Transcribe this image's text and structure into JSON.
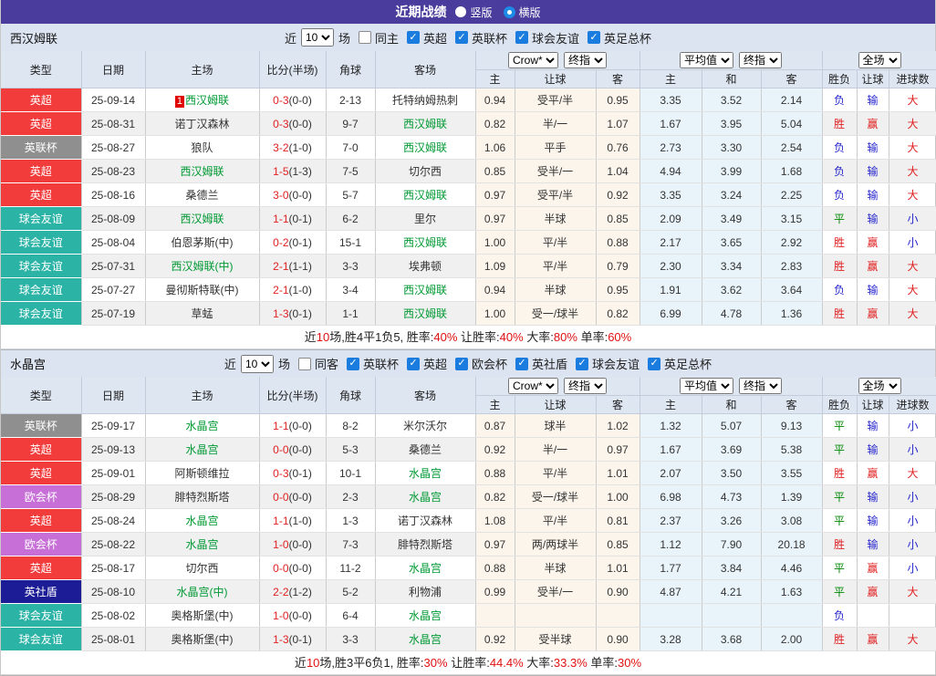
{
  "header": {
    "title": "近期战绩",
    "radios": [
      {
        "label": "竖版",
        "selected": false
      },
      {
        "label": "横版",
        "selected": true
      }
    ]
  },
  "table_headers": {
    "type": "类型",
    "date": "日期",
    "home": "主场",
    "score": "比分(半场)",
    "corner": "角球",
    "away": "客场",
    "selects": {
      "bookmaker": "Crow*",
      "final1": "终指",
      "average": "平均值",
      "final2": "终指",
      "fulltime": "全场"
    },
    "sub": [
      "主",
      "让球",
      "客",
      "主",
      "和",
      "客",
      "胜负",
      "让球",
      "进球数"
    ]
  },
  "colors": {
    "league": {
      "英超": "#f23b3b",
      "英联杯": "#8f8f8f",
      "球会友谊": "#2bb3a6",
      "欧会杯": "#c76fd6",
      "英社盾": "#1c1c96"
    },
    "result": {
      "r": "#e02020",
      "g": "#008800",
      "b": "#2525cc"
    },
    "team_green": "#009933",
    "accent": "#4a3c9c"
  },
  "sections": [
    {
      "team": "西汉姆联",
      "filter": {
        "near_label": "近",
        "count": "10",
        "games_label": "场",
        "same_label": "同主",
        "same_checked": false,
        "leagues": [
          {
            "label": "英超",
            "checked": true
          },
          {
            "label": "英联杯",
            "checked": true
          },
          {
            "label": "球会友谊",
            "checked": true
          },
          {
            "label": "英足总杯",
            "checked": true
          }
        ]
      },
      "rows": [
        {
          "type": "英超",
          "date": "25-09-14",
          "rank": "1",
          "home": "西汉姆联",
          "home_green": true,
          "score": "0-3",
          "half": "(0-0)",
          "corner": "2-13",
          "away": "托特纳姆热刺",
          "away_green": false,
          "h1": "0.94",
          "hc": "受平/半",
          "h2": "0.95",
          "e1": "3.35",
          "e2": "3.52",
          "e3": "2.14",
          "r1": "负",
          "c1": "b",
          "r2": "输",
          "c2": "b",
          "r3": "大",
          "c3": "r"
        },
        {
          "type": "英超",
          "date": "25-08-31",
          "home": "诺丁汉森林",
          "home_green": false,
          "score": "0-3",
          "half": "(0-0)",
          "corner": "9-7",
          "away": "西汉姆联",
          "away_green": true,
          "h1": "0.82",
          "hc": "半/一",
          "h2": "1.07",
          "e1": "1.67",
          "e2": "3.95",
          "e3": "5.04",
          "r1": "胜",
          "c1": "r",
          "r2": "赢",
          "c2": "r",
          "r3": "大",
          "c3": "r"
        },
        {
          "type": "英联杯",
          "date": "25-08-27",
          "home": "狼队",
          "home_green": false,
          "score": "3-2",
          "half": "(1-0)",
          "corner": "7-0",
          "away": "西汉姆联",
          "away_green": true,
          "h1": "1.06",
          "hc": "平手",
          "h2": "0.76",
          "e1": "2.73",
          "e2": "3.30",
          "e3": "2.54",
          "r1": "负",
          "c1": "b",
          "r2": "输",
          "c2": "b",
          "r3": "大",
          "c3": "r"
        },
        {
          "type": "英超",
          "date": "25-08-23",
          "home": "西汉姆联",
          "home_green": true,
          "score": "1-5",
          "half": "(1-3)",
          "corner": "7-5",
          "away": "切尔西",
          "away_green": false,
          "h1": "0.85",
          "hc": "受半/一",
          "h2": "1.04",
          "e1": "4.94",
          "e2": "3.99",
          "e3": "1.68",
          "r1": "负",
          "c1": "b",
          "r2": "输",
          "c2": "b",
          "r3": "大",
          "c3": "r"
        },
        {
          "type": "英超",
          "date": "25-08-16",
          "home": "桑德兰",
          "home_green": false,
          "score": "3-0",
          "half": "(0-0)",
          "corner": "5-7",
          "away": "西汉姆联",
          "away_green": true,
          "h1": "0.97",
          "hc": "受平/半",
          "h2": "0.92",
          "e1": "3.35",
          "e2": "3.24",
          "e3": "2.25",
          "r1": "负",
          "c1": "b",
          "r2": "输",
          "c2": "b",
          "r3": "大",
          "c3": "r"
        },
        {
          "type": "球会友谊",
          "date": "25-08-09",
          "home": "西汉姆联",
          "home_green": true,
          "score": "1-1",
          "half": "(0-1)",
          "corner": "6-2",
          "away": "里尔",
          "away_green": false,
          "h1": "0.97",
          "hc": "半球",
          "h2": "0.85",
          "e1": "2.09",
          "e2": "3.49",
          "e3": "3.15",
          "r1": "平",
          "c1": "g",
          "r2": "输",
          "c2": "b",
          "r3": "小",
          "c3": "b"
        },
        {
          "type": "球会友谊",
          "date": "25-08-04",
          "home": "伯恩茅斯(中)",
          "home_green": false,
          "score": "0-2",
          "half": "(0-1)",
          "corner": "15-1",
          "away": "西汉姆联",
          "away_green": true,
          "h1": "1.00",
          "hc": "平/半",
          "h2": "0.88",
          "e1": "2.17",
          "e2": "3.65",
          "e3": "2.92",
          "r1": "胜",
          "c1": "r",
          "r2": "赢",
          "c2": "r",
          "r3": "小",
          "c3": "b"
        },
        {
          "type": "球会友谊",
          "date": "25-07-31",
          "home": "西汉姆联(中)",
          "home_green": true,
          "score": "2-1",
          "half": "(1-1)",
          "corner": "3-3",
          "away": "埃弗顿",
          "away_green": false,
          "h1": "1.09",
          "hc": "平/半",
          "h2": "0.79",
          "e1": "2.30",
          "e2": "3.34",
          "e3": "2.83",
          "r1": "胜",
          "c1": "r",
          "r2": "赢",
          "c2": "r",
          "r3": "大",
          "c3": "r"
        },
        {
          "type": "球会友谊",
          "date": "25-07-27",
          "home": "曼彻斯特联(中)",
          "home_green": false,
          "score": "2-1",
          "half": "(1-0)",
          "corner": "3-4",
          "away": "西汉姆联",
          "away_green": true,
          "h1": "0.94",
          "hc": "半球",
          "h2": "0.95",
          "e1": "1.91",
          "e2": "3.62",
          "e3": "3.64",
          "r1": "负",
          "c1": "b",
          "r2": "输",
          "c2": "b",
          "r3": "大",
          "c3": "r"
        },
        {
          "type": "球会友谊",
          "date": "25-07-19",
          "home": "草蜢",
          "home_green": false,
          "score": "1-3",
          "half": "(0-1)",
          "corner": "1-1",
          "away": "西汉姆联",
          "away_green": true,
          "h1": "1.00",
          "hc": "受一/球半",
          "h2": "0.82",
          "e1": "6.99",
          "e2": "4.78",
          "e3": "1.36",
          "r1": "胜",
          "c1": "r",
          "r2": "赢",
          "c2": "r",
          "r3": "大",
          "c3": "r"
        }
      ],
      "summary": [
        {
          "t": "近"
        },
        {
          "t": "10",
          "red": true
        },
        {
          "t": "场,胜4平1负5, 胜率:"
        },
        {
          "t": "40%",
          "red": true
        },
        {
          "t": " 让胜率:"
        },
        {
          "t": "40%",
          "red": true
        },
        {
          "t": " 大率:"
        },
        {
          "t": "80%",
          "red": true
        },
        {
          "t": " 单率:"
        },
        {
          "t": "60%",
          "red": true
        }
      ]
    },
    {
      "team": "水晶宫",
      "filter": {
        "near_label": "近",
        "count": "10",
        "games_label": "场",
        "same_label": "同客",
        "same_checked": false,
        "leagues": [
          {
            "label": "英联杯",
            "checked": true
          },
          {
            "label": "英超",
            "checked": true
          },
          {
            "label": "欧会杯",
            "checked": true
          },
          {
            "label": "英社盾",
            "checked": true
          },
          {
            "label": "球会友谊",
            "checked": true
          },
          {
            "label": "英足总杯",
            "checked": true
          }
        ]
      },
      "rows": [
        {
          "type": "英联杯",
          "date": "25-09-17",
          "home": "水晶宫",
          "home_green": true,
          "score": "1-1",
          "half": "(0-0)",
          "corner": "8-2",
          "away": "米尔沃尔",
          "away_green": false,
          "h1": "0.87",
          "hc": "球半",
          "h2": "1.02",
          "e1": "1.32",
          "e2": "5.07",
          "e3": "9.13",
          "r1": "平",
          "c1": "g",
          "r2": "输",
          "c2": "b",
          "r3": "小",
          "c3": "b"
        },
        {
          "type": "英超",
          "date": "25-09-13",
          "home": "水晶宫",
          "home_green": true,
          "score": "0-0",
          "half": "(0-0)",
          "corner": "5-3",
          "away": "桑德兰",
          "away_green": false,
          "h1": "0.92",
          "hc": "半/一",
          "h2": "0.97",
          "e1": "1.67",
          "e2": "3.69",
          "e3": "5.38",
          "r1": "平",
          "c1": "g",
          "r2": "输",
          "c2": "b",
          "r3": "小",
          "c3": "b"
        },
        {
          "type": "英超",
          "date": "25-09-01",
          "home": "阿斯顿维拉",
          "home_green": false,
          "score": "0-3",
          "half": "(0-1)",
          "corner": "10-1",
          "away": "水晶宫",
          "away_green": true,
          "h1": "0.88",
          "hc": "平/半",
          "h2": "1.01",
          "e1": "2.07",
          "e2": "3.50",
          "e3": "3.55",
          "r1": "胜",
          "c1": "r",
          "r2": "赢",
          "c2": "r",
          "r3": "大",
          "c3": "r"
        },
        {
          "type": "欧会杯",
          "date": "25-08-29",
          "home": "腓特烈斯塔",
          "home_green": false,
          "score": "0-0",
          "half": "(0-0)",
          "corner": "2-3",
          "away": "水晶宫",
          "away_green": true,
          "h1": "0.82",
          "hc": "受一/球半",
          "h2": "1.00",
          "e1": "6.98",
          "e2": "4.73",
          "e3": "1.39",
          "r1": "平",
          "c1": "g",
          "r2": "输",
          "c2": "b",
          "r3": "小",
          "c3": "b"
        },
        {
          "type": "英超",
          "date": "25-08-24",
          "home": "水晶宫",
          "home_green": true,
          "score": "1-1",
          "half": "(1-0)",
          "corner": "1-3",
          "away": "诺丁汉森林",
          "away_green": false,
          "h1": "1.08",
          "hc": "平/半",
          "h2": "0.81",
          "e1": "2.37",
          "e2": "3.26",
          "e3": "3.08",
          "r1": "平",
          "c1": "g",
          "r2": "输",
          "c2": "b",
          "r3": "小",
          "c3": "b"
        },
        {
          "type": "欧会杯",
          "date": "25-08-22",
          "home": "水晶宫",
          "home_green": true,
          "score": "1-0",
          "half": "(0-0)",
          "corner": "7-3",
          "away": "腓特烈斯塔",
          "away_green": false,
          "h1": "0.97",
          "hc": "两/两球半",
          "h2": "0.85",
          "e1": "1.12",
          "e2": "7.90",
          "e3": "20.18",
          "r1": "胜",
          "c1": "r",
          "r2": "输",
          "c2": "b",
          "r3": "小",
          "c3": "b"
        },
        {
          "type": "英超",
          "date": "25-08-17",
          "home": "切尔西",
          "home_green": false,
          "score": "0-0",
          "half": "(0-0)",
          "corner": "11-2",
          "away": "水晶宫",
          "away_green": true,
          "h1": "0.88",
          "hc": "半球",
          "h2": "1.01",
          "e1": "1.77",
          "e2": "3.84",
          "e3": "4.46",
          "r1": "平",
          "c1": "g",
          "r2": "赢",
          "c2": "r",
          "r3": "小",
          "c3": "b"
        },
        {
          "type": "英社盾",
          "date": "25-08-10",
          "home": "水晶宫(中)",
          "home_green": true,
          "score": "2-2",
          "half": "(1-2)",
          "corner": "5-2",
          "away": "利物浦",
          "away_green": false,
          "h1": "0.99",
          "hc": "受半/一",
          "h2": "0.90",
          "e1": "4.87",
          "e2": "4.21",
          "e3": "1.63",
          "r1": "平",
          "c1": "g",
          "r2": "赢",
          "c2": "r",
          "r3": "大",
          "c3": "r"
        },
        {
          "type": "球会友谊",
          "date": "25-08-02",
          "home": "奥格斯堡(中)",
          "home_green": false,
          "score": "1-0",
          "half": "(0-0)",
          "corner": "6-4",
          "away": "水晶宫",
          "away_green": true,
          "h1": "",
          "hc": "",
          "h2": "",
          "e1": "",
          "e2": "",
          "e3": "",
          "r1": "负",
          "c1": "b",
          "r2": "",
          "c2": "b",
          "r3": "",
          "c3": "b"
        },
        {
          "type": "球会友谊",
          "date": "25-08-01",
          "home": "奥格斯堡(中)",
          "home_green": false,
          "score": "1-3",
          "half": "(0-1)",
          "corner": "3-3",
          "away": "水晶宫",
          "away_green": true,
          "h1": "0.92",
          "hc": "受半球",
          "h2": "0.90",
          "e1": "3.28",
          "e2": "3.68",
          "e3": "2.00",
          "r1": "胜",
          "c1": "r",
          "r2": "赢",
          "c2": "r",
          "r3": "大",
          "c3": "r"
        }
      ],
      "summary": [
        {
          "t": "近"
        },
        {
          "t": "10",
          "red": true
        },
        {
          "t": "场,胜3平6负1, 胜率:"
        },
        {
          "t": "30%",
          "red": true
        },
        {
          "t": " 让胜率:"
        },
        {
          "t": "44.4%",
          "red": true
        },
        {
          "t": " 大率:"
        },
        {
          "t": "33.3%",
          "red": true
        },
        {
          "t": " 单率:"
        },
        {
          "t": "30%",
          "red": true
        }
      ]
    }
  ]
}
